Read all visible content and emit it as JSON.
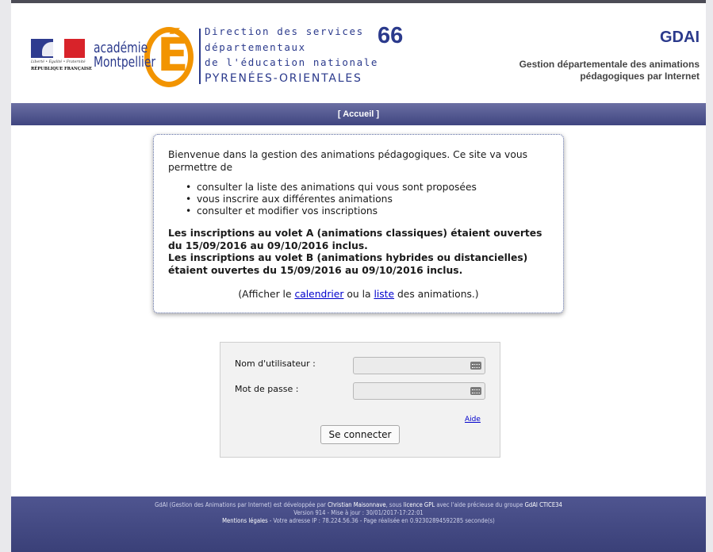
{
  "header": {
    "rf_motto": "Liberté • Égalité • Fraternité",
    "rf_name": "RÉPUBLIQUE FRANÇAISE",
    "academie_line1": "académie",
    "academie_line2": "Montpellier",
    "academie_letter": "É",
    "direction_lines": [
      "Direction des services",
      "départementaux",
      "de l'éducation nationale"
    ],
    "department": "PYRENÉES-ORIENTALES",
    "department_number": "66",
    "app_name": "GDAI",
    "app_subtitle_line1": "Gestion départementale des animations",
    "app_subtitle_line2": "pédagogiques par Internet"
  },
  "nav": {
    "home_link": "[ Accueil ]"
  },
  "welcome": {
    "intro": "Bienvenue dans la gestion des animations pédagogiques. Ce site va vous permettre de",
    "items": [
      "consulter la liste des animations qui vous sont proposées",
      "vous inscrire aux différentes animations",
      "consulter et modifier vos inscriptions"
    ],
    "notice_a": "Les inscriptions au volet A (animations classiques) étaient ouvertes du 15/09/2016 au 09/10/2016 inclus.",
    "notice_b": "Les inscriptions au volet B (animations hybrides ou distancielles) étaient ouvertes du 15/09/2016 au 09/10/2016 inclus.",
    "links_prefix": "(Afficher le ",
    "calendar_link": "calendrier",
    "links_middle": " ou la ",
    "list_link": "liste",
    "links_suffix": " des animations.)"
  },
  "login": {
    "username_label": "Nom d'utilisateur :",
    "username_value": "",
    "password_label": "Mot de passe :",
    "password_value": "",
    "help_link": "Aide",
    "submit_label": "Se connecter"
  },
  "footer": {
    "line1_prefix": "GdAI (Gestion des Animations par Internet) est développée par ",
    "author": "Christian Maisonnave",
    "line1_mid": ", sous ",
    "licence": "licence GPL",
    "line1_mid2": " avec l'aide précieuse du groupe ",
    "group": "GdAI CTICE34",
    "line2": "Version 914 - Mise à jour : 30/01/2017-17:22:01",
    "legal": "Mentions légales",
    "line3": " - Votre adresse IP : 78.224.56.36 - Page réalisée en 0.92302894592285 seconde(s)"
  },
  "colors": {
    "brand_blue": "#2b3a8c",
    "academie_orange": "#f29400",
    "nav_bar": "#4a508a",
    "link": "#0000cc"
  }
}
